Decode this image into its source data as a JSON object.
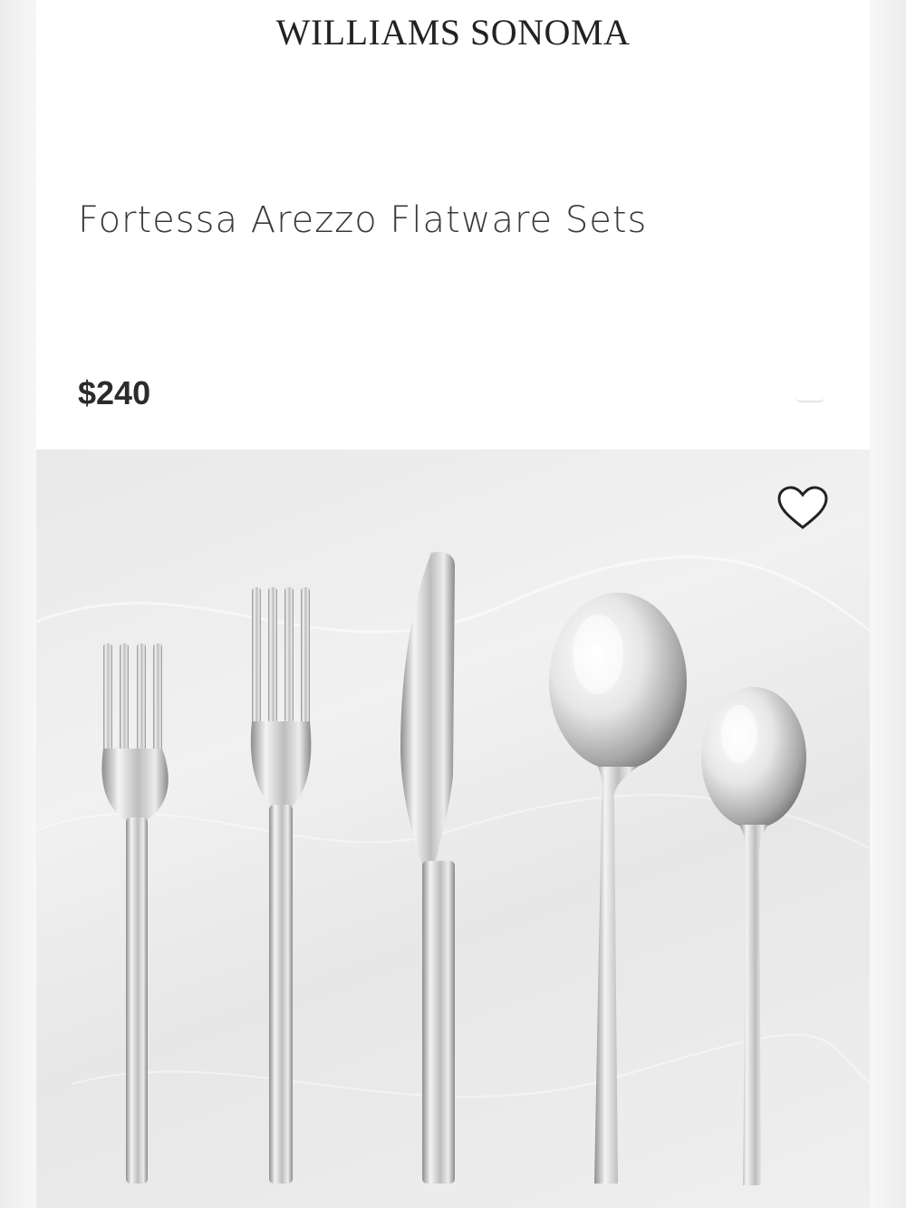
{
  "header": {
    "brand": "WILLIAMS SONOMA"
  },
  "product": {
    "title": "Fortessa Arezzo Flatware Sets",
    "price": "$240"
  },
  "image": {
    "items": [
      "salad-fork",
      "dinner-fork",
      "dinner-knife",
      "table-spoon",
      "teaspoon"
    ]
  },
  "icons": {
    "favorite": "heart-outline-icon"
  },
  "colors": {
    "text": "#3a3a3a",
    "background": "#ffffff",
    "marble": "#ececec",
    "steel": "#c9c9c9"
  }
}
